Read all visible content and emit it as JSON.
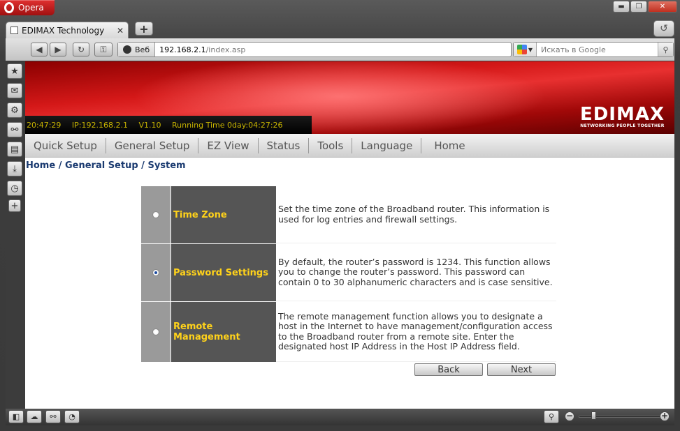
{
  "browser": {
    "menu_label": "Opera",
    "tab_title": "EDIMAX Technology",
    "tab_close": "✕",
    "newtab_label": "+",
    "address": {
      "web_label": "Веб",
      "host": "192.168.2.1",
      "path": "/index.asp"
    },
    "search": {
      "placeholder": "Искать в Google"
    }
  },
  "banner": {
    "time": "20:47:29",
    "ip": "IP:192.168.2.1",
    "version": "V1.10",
    "running_time": "Running Time 0day:04:27:26",
    "logo": "EDIMAX",
    "tagline": "NETWORKING PEOPLE TOGETHER"
  },
  "menu": [
    {
      "label": "Quick Setup"
    },
    {
      "label": "General Setup"
    },
    {
      "label": "EZ View"
    },
    {
      "label": "Status"
    },
    {
      "label": "Tools"
    },
    {
      "label": "Language"
    },
    {
      "label": "Home"
    }
  ],
  "breadcrumb": "Home / General Setup / System",
  "options": [
    {
      "label": "Time Zone",
      "selected": false,
      "description": "Set the time zone of the Broadband router. This information is used for log entries and firewall settings."
    },
    {
      "label": "Password Settings",
      "selected": true,
      "description": "By default, the router’s password is 1234. This function allows you to change the router’s password. This password can contain 0 to 30 alphanumeric characters and is case sensitive."
    },
    {
      "label": "Remote Management",
      "selected": false,
      "description": "The remote management function allows you to designate a host in the Internet to have management/configuration access to the Broadband router from a remote site. Enter the designated host IP Address in the Host IP Address field."
    }
  ],
  "buttons": {
    "back": "Back",
    "next": "Next"
  },
  "colors": {
    "option_label": "#ffd21a",
    "breadcrumb": "#1a3a70",
    "banner_red": "#d41818"
  }
}
